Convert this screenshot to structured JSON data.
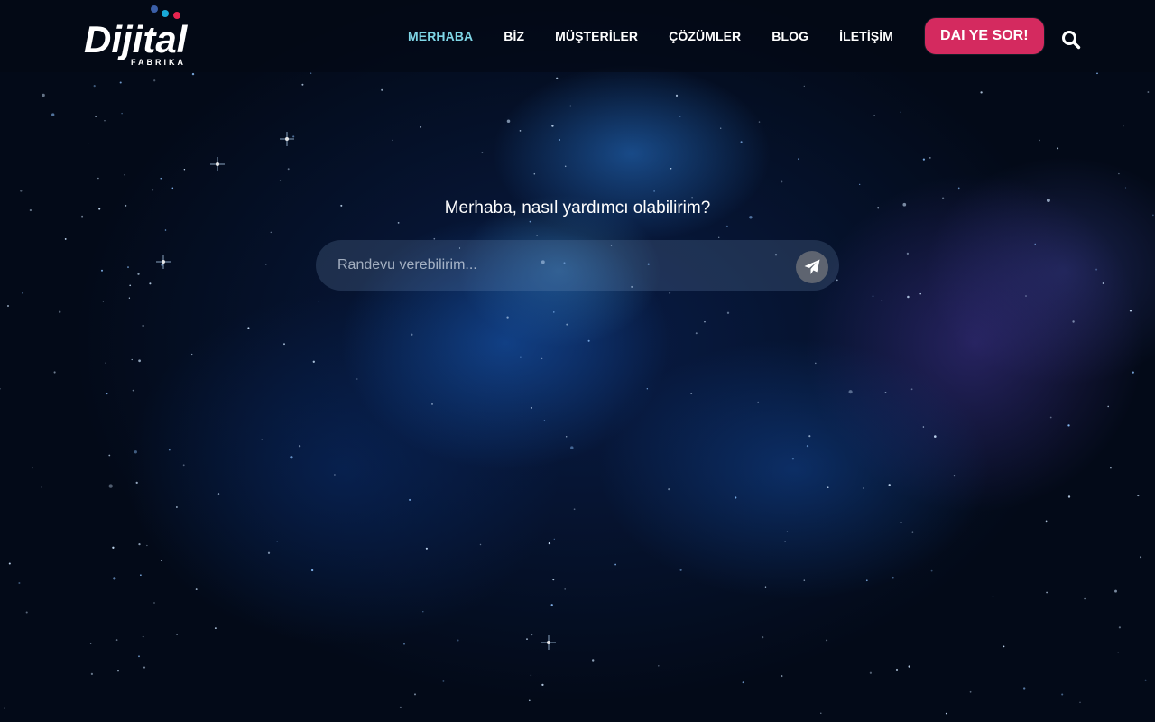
{
  "brand": {
    "logo_text": "Dijital",
    "logo_subtext": "FABRIKA",
    "dot_colors": [
      "#3b5fa8",
      "#19a9d8",
      "#e8244f"
    ]
  },
  "nav": {
    "items": [
      {
        "label": "MERHABA",
        "active": true
      },
      {
        "label": "BİZ",
        "active": false
      },
      {
        "label": "MÜŞTERİLER",
        "active": false
      },
      {
        "label": "ÇÖZÜMLER",
        "active": false
      },
      {
        "label": "BLOG",
        "active": false
      },
      {
        "label": "İLETİŞİM",
        "active": false
      }
    ],
    "cta_label": "DAI YE SOR!",
    "search_icon": "search-icon"
  },
  "hero": {
    "greeting": "Merhaba, nasıl yardımcı olabilirim?",
    "input_placeholder": "Randevu verebilirim...",
    "input_value": "",
    "send_icon": "paper-plane-icon"
  },
  "colors": {
    "accent": "#7fd6e6",
    "cta": "#d42a5f",
    "background": "#030a18"
  }
}
